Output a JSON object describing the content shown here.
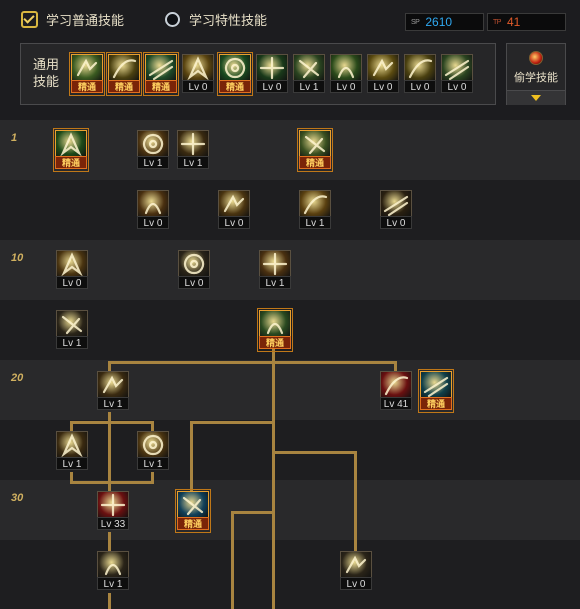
{
  "tabs": {
    "normal": "学习普通技能",
    "trait": "学习特性技能"
  },
  "sp": {
    "label": "SP",
    "value": "2610",
    "tp_label": "TP",
    "tp_value": "41"
  },
  "common": {
    "label": "通用技能",
    "skills": [
      {
        "id": "c1",
        "tag": "精通",
        "icon": "sprint-icon",
        "color": "#3a5a20"
      },
      {
        "id": "c2",
        "tag": "精通",
        "icon": "jump-icon",
        "color": "#4a4010"
      },
      {
        "id": "c3",
        "tag": "精通",
        "icon": "dash-icon",
        "color": "#1e4a28"
      },
      {
        "id": "c4",
        "tag": "Lv 0",
        "icon": "wings-icon",
        "color": "#5a4410"
      },
      {
        "id": "c5",
        "tag": "精通",
        "icon": "target-icon",
        "color": "#1a4a20"
      },
      {
        "id": "c6",
        "tag": "Lv 0",
        "icon": "crosshair-icon",
        "color": "#1a3a1a"
      },
      {
        "id": "c7",
        "tag": "Lv 1",
        "icon": "strike-icon",
        "color": "#2a4420"
      },
      {
        "id": "c8",
        "tag": "Lv 0",
        "icon": "fist-icon",
        "color": "#2a4a1a"
      },
      {
        "id": "c9",
        "tag": "Lv 0",
        "icon": "eye-icon",
        "color": "#5a4a10"
      },
      {
        "id": "c10",
        "tag": "Lv 0",
        "icon": "hero-icon",
        "color": "#4a4010"
      },
      {
        "id": "c11",
        "tag": "Lv 0",
        "icon": "blade-icon",
        "color": "#2a4420"
      }
    ],
    "steal_label": "偷学技能"
  },
  "level_labels": {
    "r1": "1",
    "r3": "10",
    "r5": "20",
    "r7": "30"
  },
  "tree": [
    {
      "id": "t1",
      "tag": "精通",
      "icon": "rune-icon",
      "color": "#1e4a18"
    },
    {
      "id": "t2",
      "tag": "Lv 1",
      "icon": "slash-icon",
      "color": "#4a3210"
    },
    {
      "id": "t3",
      "tag": "Lv 1",
      "icon": "claw-icon",
      "color": "#3a2a10"
    },
    {
      "id": "t4",
      "tag": "精通",
      "icon": "kick-icon",
      "color": "#3a5020"
    },
    {
      "id": "t5",
      "tag": "Lv 0",
      "icon": "burst-icon",
      "color": "#4a3010"
    },
    {
      "id": "t6",
      "tag": "Lv 0",
      "icon": "arrows-icon",
      "color": "#4a3410"
    },
    {
      "id": "t7",
      "tag": "Lv 1",
      "icon": "sweep-icon",
      "color": "#5a4010"
    },
    {
      "id": "t8",
      "tag": "Lv 0",
      "icon": "shield-icon",
      "color": "#2a2010"
    },
    {
      "id": "t9",
      "tag": "Lv 0",
      "icon": "wing-slash-icon",
      "color": "#4a3410"
    },
    {
      "id": "t10",
      "tag": "Lv 0",
      "icon": "crescent-icon",
      "color": "#2a2418"
    },
    {
      "id": "t11",
      "tag": "Lv 1",
      "icon": "eruption-icon",
      "color": "#4a3010"
    },
    {
      "id": "t12",
      "tag": "Lv 1",
      "icon": "cut-icon",
      "color": "#2a2418"
    },
    {
      "id": "t13",
      "tag": "精通",
      "icon": "lightning-icon",
      "color": "#2a4a20"
    },
    {
      "id": "t14",
      "tag": "Lv 1",
      "icon": "arc-icon",
      "color": "#3a2a10"
    },
    {
      "id": "t15",
      "tag": "Lv 41",
      "icon": "blood-icon",
      "color": "#6a1010"
    },
    {
      "id": "t16",
      "tag": "精通",
      "icon": "ghost-icon",
      "color": "#10404a"
    },
    {
      "id": "t17",
      "tag": "Lv 1",
      "icon": "fang-icon",
      "color": "#3a2a10"
    },
    {
      "id": "t18",
      "tag": "Lv 1",
      "icon": "barrage-icon",
      "color": "#4a3410"
    },
    {
      "id": "t19",
      "tag": "Lv 33",
      "icon": "vortex-icon",
      "color": "#6a1010"
    },
    {
      "id": "t20",
      "tag": "精通",
      "icon": "storm-icon",
      "color": "#10405a"
    },
    {
      "id": "t21",
      "tag": "Lv 1",
      "icon": "whirl-icon",
      "color": "#2a2418"
    },
    {
      "id": "t22",
      "tag": "Lv 0",
      "icon": "scatter-icon",
      "color": "#2a2418"
    }
  ]
}
